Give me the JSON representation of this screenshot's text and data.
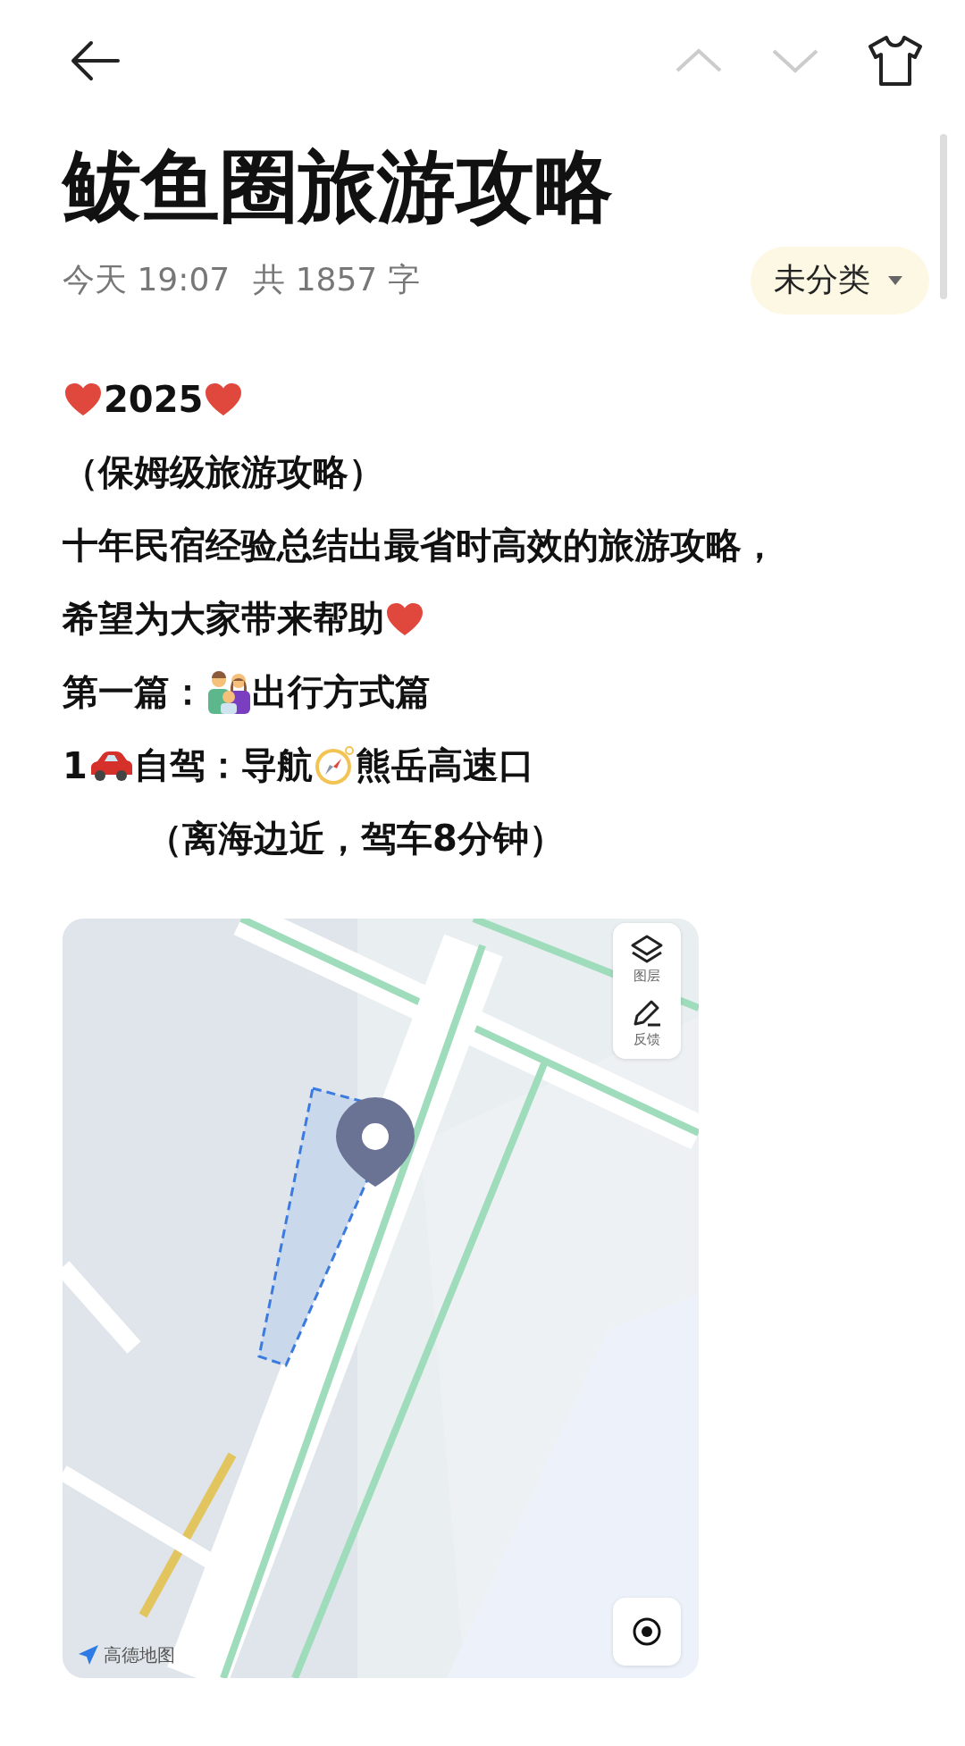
{
  "title": "鲅鱼圈旅游攻略",
  "meta": {
    "date": "今天 19:07",
    "count": "共 1857 字"
  },
  "category": {
    "label": "未分类",
    "expanded": false
  },
  "body": [
    {
      "parts": [
        {
          "kind": "heart"
        },
        {
          "kind": "text",
          "text": "2025"
        },
        {
          "kind": "heart"
        }
      ]
    },
    {
      "parts": [
        {
          "kind": "text",
          "text": "（保姆级旅游攻略）"
        }
      ]
    },
    {
      "parts": [
        {
          "kind": "text",
          "text": "十年民宿经验总结出最省时高效的旅游攻略，"
        }
      ]
    },
    {
      "parts": [
        {
          "kind": "text",
          "text": "希望为大家带来帮助"
        },
        {
          "kind": "heart"
        }
      ]
    },
    {
      "parts": [
        {
          "kind": "text",
          "text": "第一篇："
        },
        {
          "kind": "family"
        },
        {
          "kind": "text",
          "text": "出行方式篇"
        }
      ]
    },
    {
      "parts": [
        {
          "kind": "text",
          "text": "1"
        },
        {
          "kind": "car"
        },
        {
          "kind": "text",
          "text": "自驾：导航"
        },
        {
          "kind": "compass"
        },
        {
          "kind": "text",
          "text": "熊岳高速口"
        }
      ],
      "children": [
        {
          "parts": [
            {
              "kind": "text",
              "text": "（离海边近，驾车8分钟）"
            }
          ]
        }
      ]
    }
  ],
  "map": {
    "kind": "picture",
    "controls": [
      {
        "kind": "layers",
        "label": "图层"
      },
      {
        "kind": "feedback",
        "label": "反馈"
      }
    ],
    "logo": "高德地图"
  }
}
